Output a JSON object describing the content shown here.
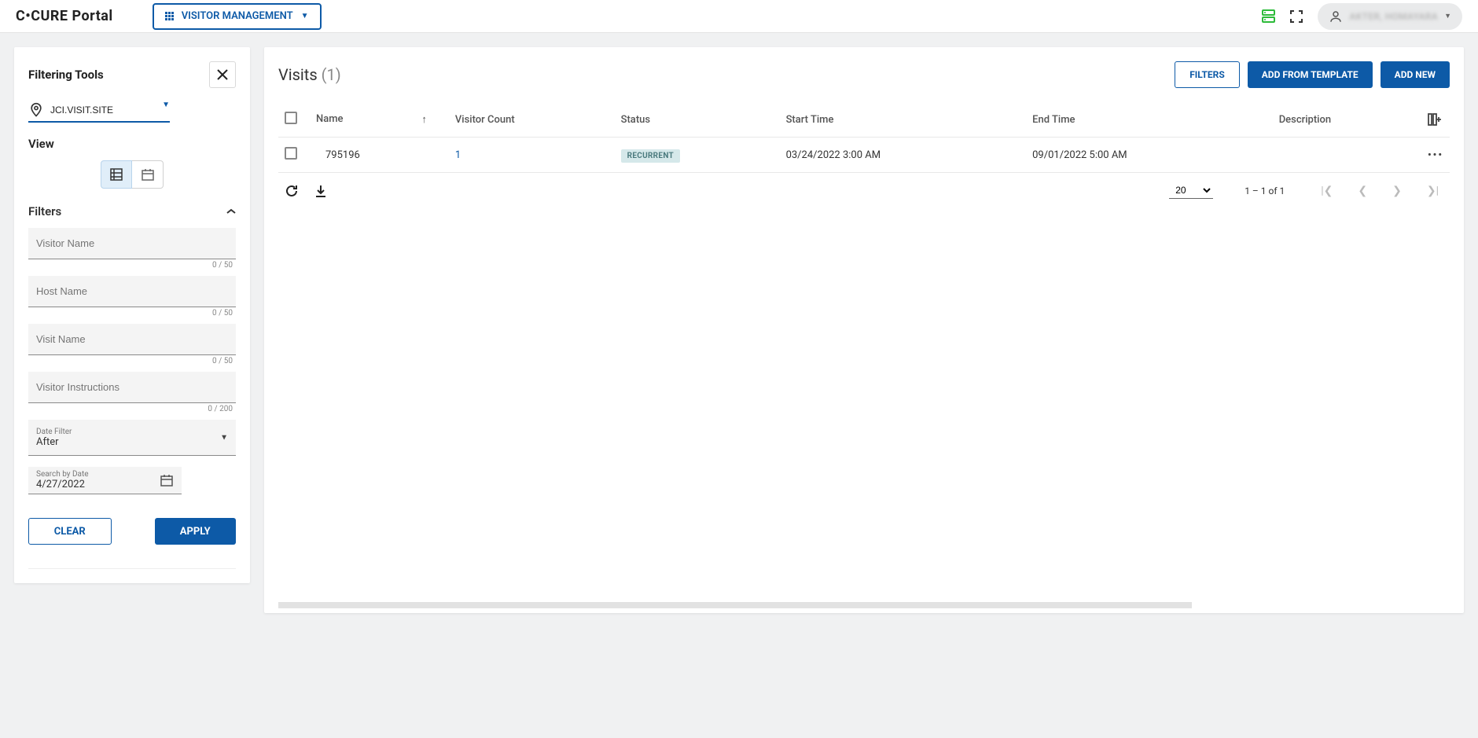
{
  "header": {
    "logo": "C•CURE Portal",
    "module": "VISITOR MANAGEMENT",
    "user_name": "AKTER, HOMAYARA"
  },
  "sidebar": {
    "title": "Filtering Tools",
    "site": "JCI.VISIT.SITE",
    "view_label": "View",
    "filters_label": "Filters",
    "fields": {
      "visitor_name": {
        "placeholder": "Visitor Name",
        "counter": "0 / 50"
      },
      "host_name": {
        "placeholder": "Host Name",
        "counter": "0 / 50"
      },
      "visit_name": {
        "placeholder": "Visit Name",
        "counter": "0 / 50"
      },
      "visitor_instructions": {
        "placeholder": "Visitor Instructions",
        "counter": "0 / 200"
      },
      "date_filter": {
        "label": "Date Filter",
        "value": "After"
      },
      "search_date": {
        "label": "Search by Date",
        "value": "4/27/2022"
      }
    },
    "buttons": {
      "clear": "CLEAR",
      "apply": "APPLY"
    }
  },
  "main": {
    "title": "Visits",
    "count": "(1)",
    "buttons": {
      "filters": "FILTERS",
      "add_template": "ADD FROM TEMPLATE",
      "add_new": "ADD NEW"
    },
    "columns": {
      "name": "Name",
      "visitor_count": "Visitor Count",
      "status": "Status",
      "start_time": "Start Time",
      "end_time": "End Time",
      "description": "Description"
    },
    "rows": [
      {
        "name": "795196",
        "visitor_count": "1",
        "status": "RECURRENT",
        "start_time": "03/24/2022 3:00 AM",
        "end_time": "09/01/2022 5:00 AM",
        "description": ""
      }
    ],
    "pagination": {
      "page_size": "20",
      "range": "1 – 1 of 1"
    }
  }
}
